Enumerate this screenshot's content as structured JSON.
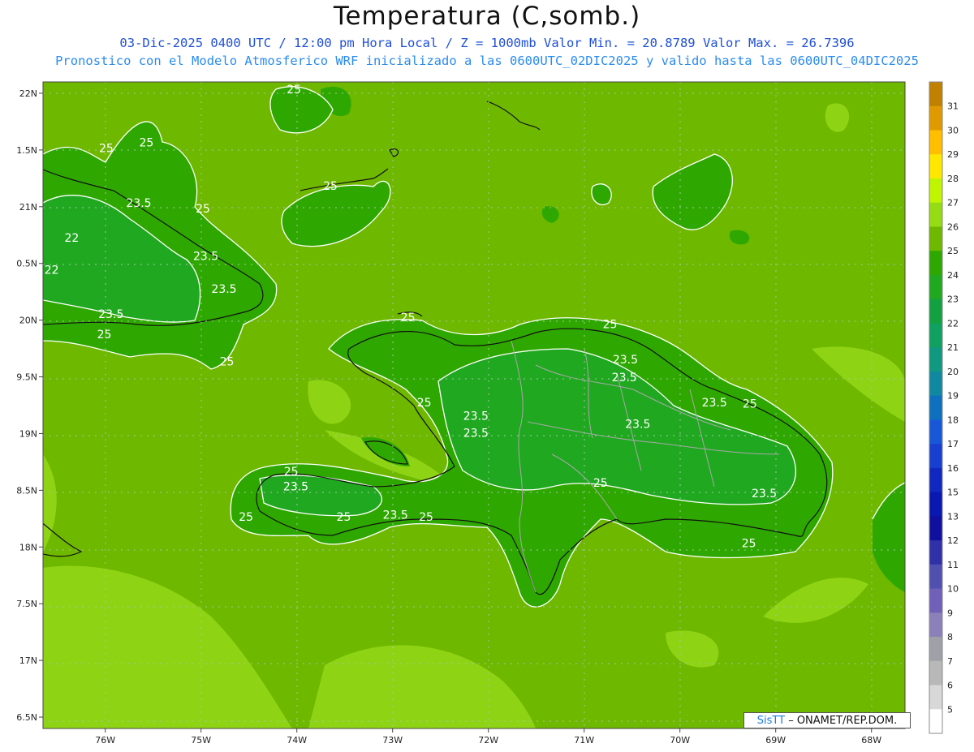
{
  "title": "Temperatura (C,somb.)",
  "subtitle_line1": "03-Dic-2025 0400 UTC / 12:00 pm Hora Local / Z = 1000mb  Valor Min. = 20.8789  Valor Max. = 26.7396",
  "subtitle_line2": "Pronostico con el Modelo Atmosferico WRF inicializado a las 0600UTC_02DIC2025 y valido hasta las  0600UTC_04DIC2025",
  "credit": {
    "logo": "SisTT",
    "text": " – ONAMET/REP.DOM."
  },
  "axes": {
    "lon_labels": [
      "76W",
      "75W",
      "74W",
      "73W",
      "72W",
      "71W",
      "70W",
      "69W",
      "68W"
    ],
    "lat_labels": [
      "22N",
      "1.5N",
      "21N",
      "0.5N",
      "20N",
      "9.5N",
      "19N",
      "8.5N",
      "18N",
      "7.5N",
      "17N",
      "6.5N"
    ]
  },
  "colorbar": {
    "labels": [
      "31",
      "30",
      "29",
      "28",
      "27",
      "26",
      "25",
      "24",
      "23",
      "22",
      "21",
      "20",
      "19",
      "18",
      "17",
      "16",
      "15",
      "13",
      "12",
      "11",
      "10",
      "9",
      "8",
      "7",
      "6",
      "5"
    ],
    "colors": [
      "#c08000",
      "#e09a00",
      "#ffbe00",
      "#ffe800",
      "#bff500",
      "#96dc14",
      "#6eb800",
      "#2ea800",
      "#20a820",
      "#12a040",
      "#10a060",
      "#109880",
      "#1088a0",
      "#1070c0",
      "#1858d8",
      "#1840d0",
      "#1028c0",
      "#0818b0",
      "#1010a0",
      "#3030a8",
      "#5050b0",
      "#7060b8",
      "#8c80b8",
      "#a0a0a8",
      "#b8b8b8",
      "#d8d8d8",
      "#ffffff"
    ]
  },
  "contour_labels": [
    {
      "text": "25",
      "lon": -75.99,
      "lat": 21.48
    },
    {
      "text": "25",
      "lon": -75.57,
      "lat": 21.53
    },
    {
      "text": "25",
      "lon": -74.03,
      "lat": 22.0
    },
    {
      "text": "25",
      "lon": -73.65,
      "lat": 21.15
    },
    {
      "text": "25",
      "lon": -74.98,
      "lat": 20.95
    },
    {
      "text": "23.5",
      "lon": -75.65,
      "lat": 21.0
    },
    {
      "text": "22",
      "lon": -76.35,
      "lat": 20.69
    },
    {
      "text": "22",
      "lon": -76.56,
      "lat": 20.41
    },
    {
      "text": "23.5",
      "lon": -74.95,
      "lat": 20.53
    },
    {
      "text": "23.5",
      "lon": -74.76,
      "lat": 20.24
    },
    {
      "text": "23.5",
      "lon": -75.94,
      "lat": 20.02
    },
    {
      "text": "25",
      "lon": -76.01,
      "lat": 19.84
    },
    {
      "text": "25",
      "lon": -74.73,
      "lat": 19.6
    },
    {
      "text": "25",
      "lon": -72.84,
      "lat": 19.99
    },
    {
      "text": "25",
      "lon": -70.73,
      "lat": 19.93
    },
    {
      "text": "23.5",
      "lon": -70.57,
      "lat": 19.62
    },
    {
      "text": "23.5",
      "lon": -70.58,
      "lat": 19.46
    },
    {
      "text": "25",
      "lon": -72.67,
      "lat": 19.24
    },
    {
      "text": "23.5",
      "lon": -72.13,
      "lat": 19.12
    },
    {
      "text": "23.5",
      "lon": -72.13,
      "lat": 18.97
    },
    {
      "text": "23.5",
      "lon": -70.44,
      "lat": 19.05
    },
    {
      "text": "23.5",
      "lon": -69.64,
      "lat": 19.24
    },
    {
      "text": "25",
      "lon": -69.27,
      "lat": 19.23
    },
    {
      "text": "25",
      "lon": -74.06,
      "lat": 18.63
    },
    {
      "text": "23.5",
      "lon": -74.01,
      "lat": 18.5
    },
    {
      "text": "25",
      "lon": -74.53,
      "lat": 18.23
    },
    {
      "text": "25",
      "lon": -73.51,
      "lat": 18.23
    },
    {
      "text": "23.5",
      "lon": -72.97,
      "lat": 18.25
    },
    {
      "text": "25",
      "lon": -72.65,
      "lat": 18.23
    },
    {
      "text": "25",
      "lon": -70.83,
      "lat": 18.53
    },
    {
      "text": "23.5",
      "lon": -69.12,
      "lat": 18.44
    },
    {
      "text": "25",
      "lon": -69.28,
      "lat": 18.0
    }
  ]
}
